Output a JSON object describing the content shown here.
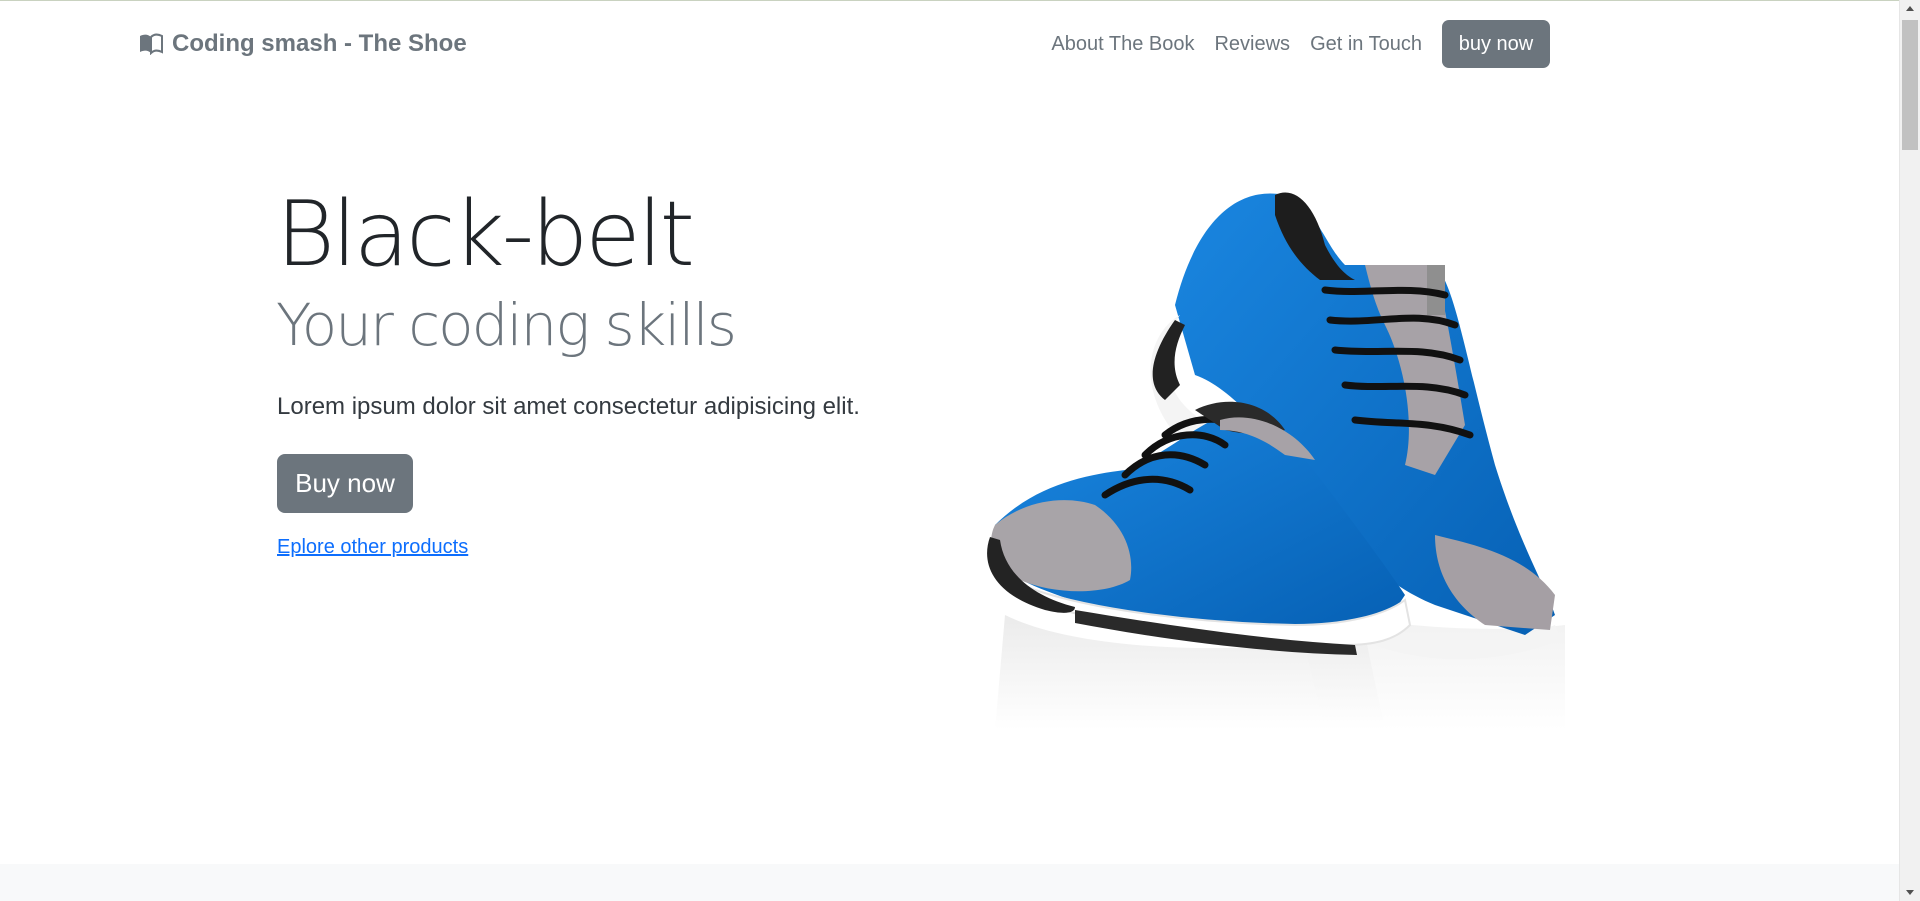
{
  "navbar": {
    "brand": "Coding smash - The Shoe",
    "brand_icon": "book-icon",
    "links": [
      {
        "label": "About The Book"
      },
      {
        "label": "Reviews"
      },
      {
        "label": "Get in Touch"
      }
    ],
    "buy_label": "buy now"
  },
  "hero": {
    "title": "Black-belt",
    "subtitle": "Your coding skills",
    "lead": "Lorem ipsum dolor sit amet consectetur adipisicing elit.",
    "buy_label": "Buy now",
    "explore_link": "Eplore other products"
  },
  "colors": {
    "secondary": "#6c757d",
    "link": "#0d6efd",
    "shoe_blue": "#0a73d1",
    "light_band": "#f8f9fa"
  },
  "icons": {
    "scroll_up": "triangle-up-icon",
    "scroll_down": "triangle-down-icon"
  }
}
